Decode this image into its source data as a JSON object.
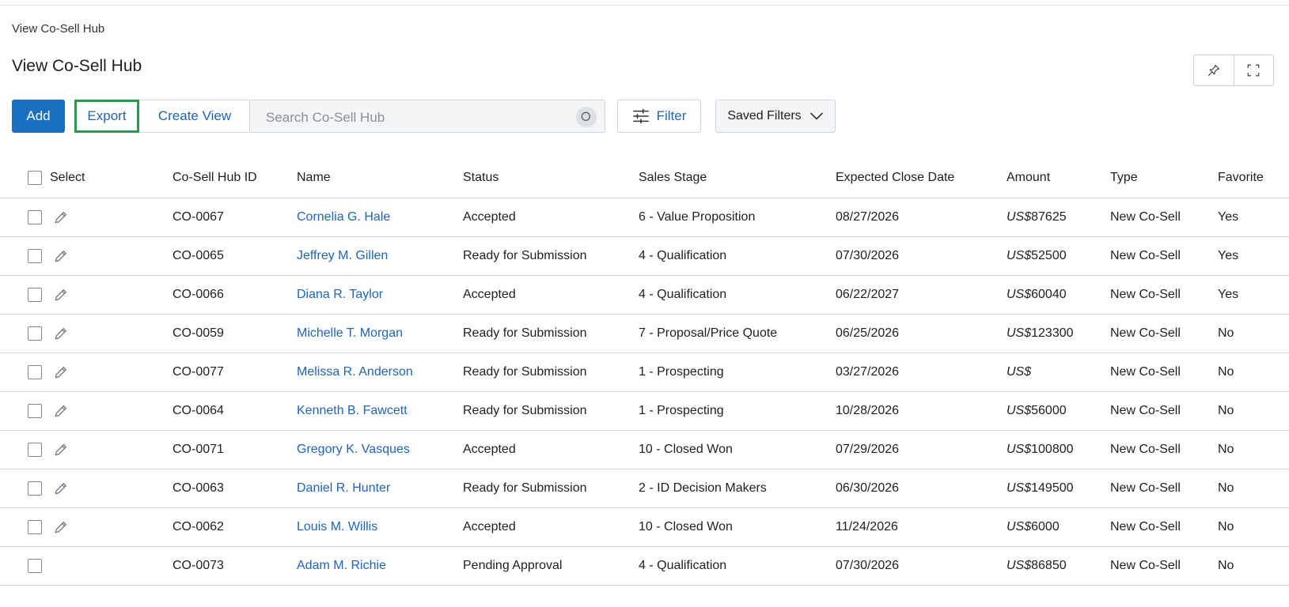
{
  "breadcrumb": "View Co-Sell Hub",
  "page_title": "View Co-Sell Hub",
  "header_icons": [
    "pin-icon",
    "expand-icon"
  ],
  "toolbar": {
    "add_label": "Add",
    "export_label": "Export",
    "create_view_label": "Create View",
    "search_placeholder": "Search Co-Sell Hub",
    "filter_label": "Filter",
    "saved_filters_label": "Saved Filters"
  },
  "colors": {
    "primary": "#1a6fc2",
    "link": "#1f64b8",
    "highlight_border": "#1ea04a"
  },
  "table": {
    "headers": {
      "select": "Select",
      "id": "Co-Sell Hub ID",
      "name": "Name",
      "status": "Status",
      "stage": "Sales Stage",
      "close_date": "Expected Close Date",
      "amount": "Amount",
      "type": "Type",
      "favorite": "Favorite"
    },
    "rows": [
      {
        "id": "CO-0067",
        "name": "Cornelia G. Hale",
        "status": "Accepted",
        "stage": "6 - Value Proposition",
        "close_date": "08/27/2026",
        "currency": "US$",
        "amount": "87625",
        "type": "New Co-Sell",
        "favorite": "Yes"
      },
      {
        "id": "CO-0065",
        "name": "Jeffrey M. Gillen",
        "status": "Ready for Submission",
        "stage": "4 - Qualification",
        "close_date": "07/30/2026",
        "currency": "US$",
        "amount": "52500",
        "type": "New Co-Sell",
        "favorite": "Yes"
      },
      {
        "id": "CO-0066",
        "name": "Diana R. Taylor",
        "status": "Accepted",
        "stage": "4 - Qualification",
        "close_date": "06/22/2027",
        "currency": "US$",
        "amount": "60040",
        "type": "New Co-Sell",
        "favorite": "Yes"
      },
      {
        "id": "CO-0059",
        "name": "Michelle T. Morgan",
        "status": "Ready for Submission",
        "stage": "7 - Proposal/Price Quote",
        "close_date": "06/25/2026",
        "currency": "US$",
        "amount": "123300",
        "type": "New Co-Sell",
        "favorite": "No"
      },
      {
        "id": "CO-0077",
        "name": "Melissa R. Anderson",
        "status": "Ready for Submission",
        "stage": "1 - Prospecting",
        "close_date": "03/27/2026",
        "currency": "US$",
        "amount": "",
        "type": "New Co-Sell",
        "favorite": "No"
      },
      {
        "id": "CO-0064",
        "name": "Kenneth B. Fawcett",
        "status": "Ready for Submission",
        "stage": "1 - Prospecting",
        "close_date": "10/28/2026",
        "currency": "US$",
        "amount": "56000",
        "type": "New Co-Sell",
        "favorite": "No"
      },
      {
        "id": "CO-0071",
        "name": "Gregory K. Vasques",
        "status": "Accepted",
        "stage": "10 - Closed Won",
        "close_date": "07/29/2026",
        "currency": "US$",
        "amount": "100800",
        "type": "New Co-Sell",
        "favorite": "No"
      },
      {
        "id": "CO-0063",
        "name": "Daniel R. Hunter",
        "status": "Ready for Submission",
        "stage": "2 - ID Decision Makers",
        "close_date": "06/30/2026",
        "currency": "US$",
        "amount": "149500",
        "type": "New Co-Sell",
        "favorite": "No"
      },
      {
        "id": "CO-0062",
        "name": "Louis M. Willis",
        "status": "Accepted",
        "stage": "10 - Closed Won",
        "close_date": "11/24/2026",
        "currency": "US$",
        "amount": "6000",
        "type": "New Co-Sell",
        "favorite": "No"
      },
      {
        "id": "CO-0073",
        "name": "Adam M. Richie",
        "status": "Pending Approval",
        "stage": "4 - Qualification",
        "close_date": "07/30/2026",
        "currency": "US$",
        "amount": "86850",
        "type": "New Co-Sell",
        "favorite": "No",
        "no_edit": true
      }
    ]
  }
}
